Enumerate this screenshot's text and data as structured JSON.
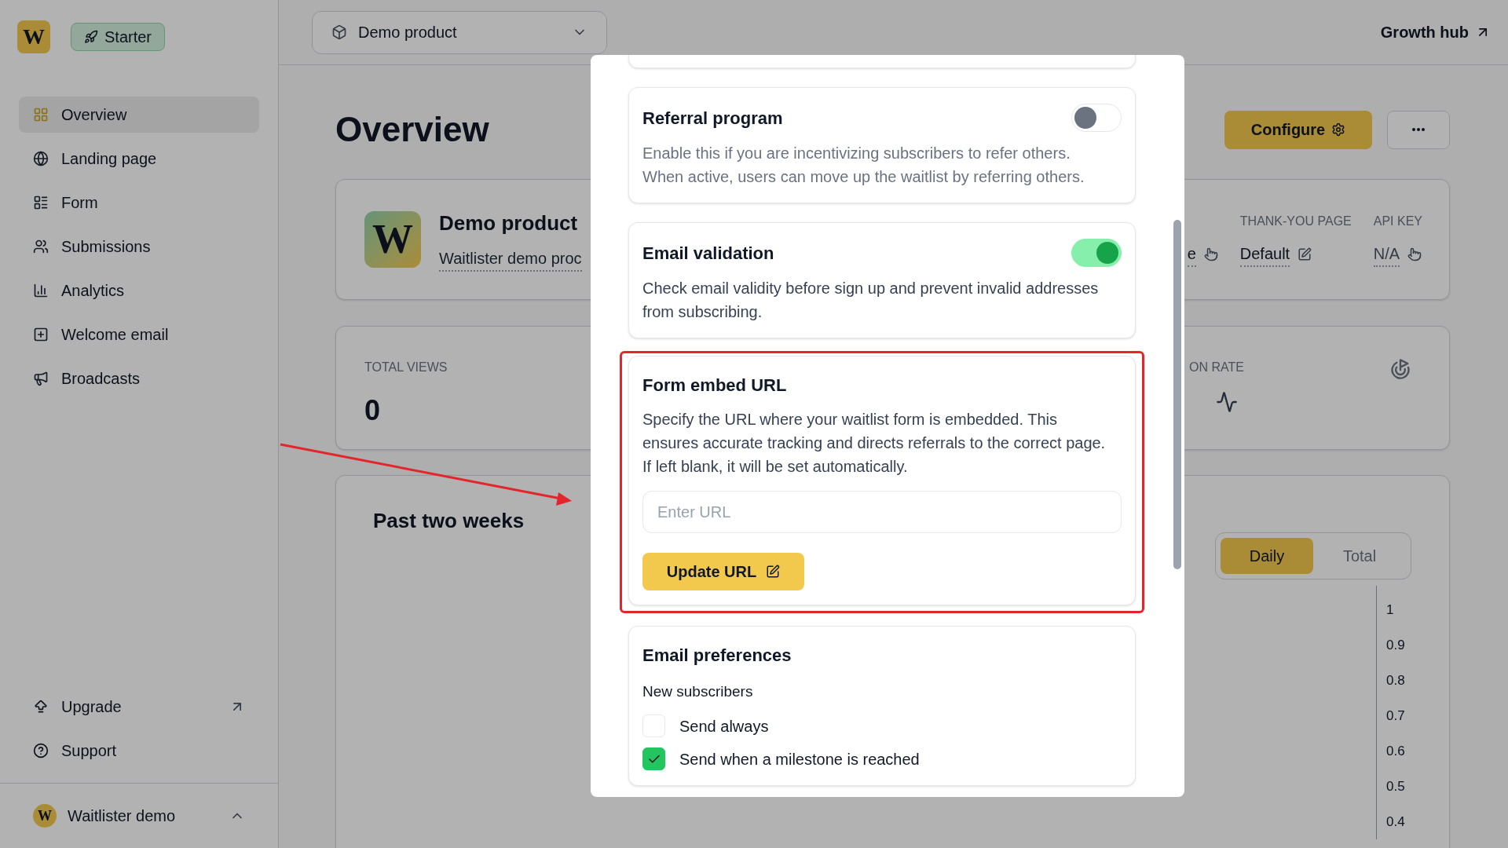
{
  "sidebar": {
    "logo_text": "W",
    "plan_badge": "Starter",
    "items": [
      {
        "label": "Overview",
        "selected": true
      },
      {
        "label": "Landing page",
        "selected": false
      },
      {
        "label": "Form",
        "selected": false
      },
      {
        "label": "Submissions",
        "selected": false
      },
      {
        "label": "Analytics",
        "selected": false
      },
      {
        "label": "Welcome email",
        "selected": false
      },
      {
        "label": "Broadcasts",
        "selected": false
      }
    ],
    "bottom_items": [
      {
        "label": "Upgrade",
        "external": true
      },
      {
        "label": "Support",
        "external": false
      }
    ],
    "account": {
      "avatar_text": "W",
      "name": "Waitlister demo"
    }
  },
  "header": {
    "product_select": "Demo product",
    "growth_hub": "Growth hub"
  },
  "overview": {
    "title": "Overview",
    "configure": "Configure",
    "product": {
      "logo_text": "W",
      "name": "Demo product",
      "link": "Waitlister demo proc",
      "partial_value": "e",
      "thank_you_label": "THANK-YOU PAGE",
      "thank_you_value": "Default",
      "api_key_label": "API KEY",
      "api_key_value": "N/A"
    },
    "stats": {
      "total_views_label": "TOTAL VIEWS",
      "total_views": "0",
      "conversion_label": "ON RATE"
    },
    "chart": {
      "title": "Past two weeks",
      "modes": [
        {
          "label": "Daily",
          "selected": true
        },
        {
          "label": "Total",
          "selected": false
        }
      ],
      "y_axis_labels": [
        "1",
        "0.9",
        "0.8",
        "0.7",
        "0.6",
        "0.5",
        "0.4"
      ]
    }
  },
  "modal": {
    "sections": [
      {
        "kind": "toggle",
        "title": "Referral program",
        "description": "Enable this if you are incentivizing subscribers to refer others. When active, users can move up the waitlist by referring others.",
        "on": false
      },
      {
        "kind": "toggle",
        "title": "Email validation",
        "description": "Check email validity before sign up and prevent invalid addresses from subscribing.",
        "on": true
      },
      {
        "kind": "url",
        "title": "Form embed URL",
        "description": "Specify the URL where your waitlist form is embedded. This ensures accurate tracking and directs referrals to the correct page. If left blank, it will be set automatically.",
        "placeholder": "Enter URL",
        "button": "Update URL",
        "highlighted": true
      },
      {
        "kind": "checkboxes",
        "title": "Email preferences",
        "subtitle": "New subscribers",
        "options": [
          {
            "label": "Send always",
            "checked": false
          },
          {
            "label": "Send when a milestone is reached",
            "checked": true
          }
        ]
      }
    ]
  }
}
